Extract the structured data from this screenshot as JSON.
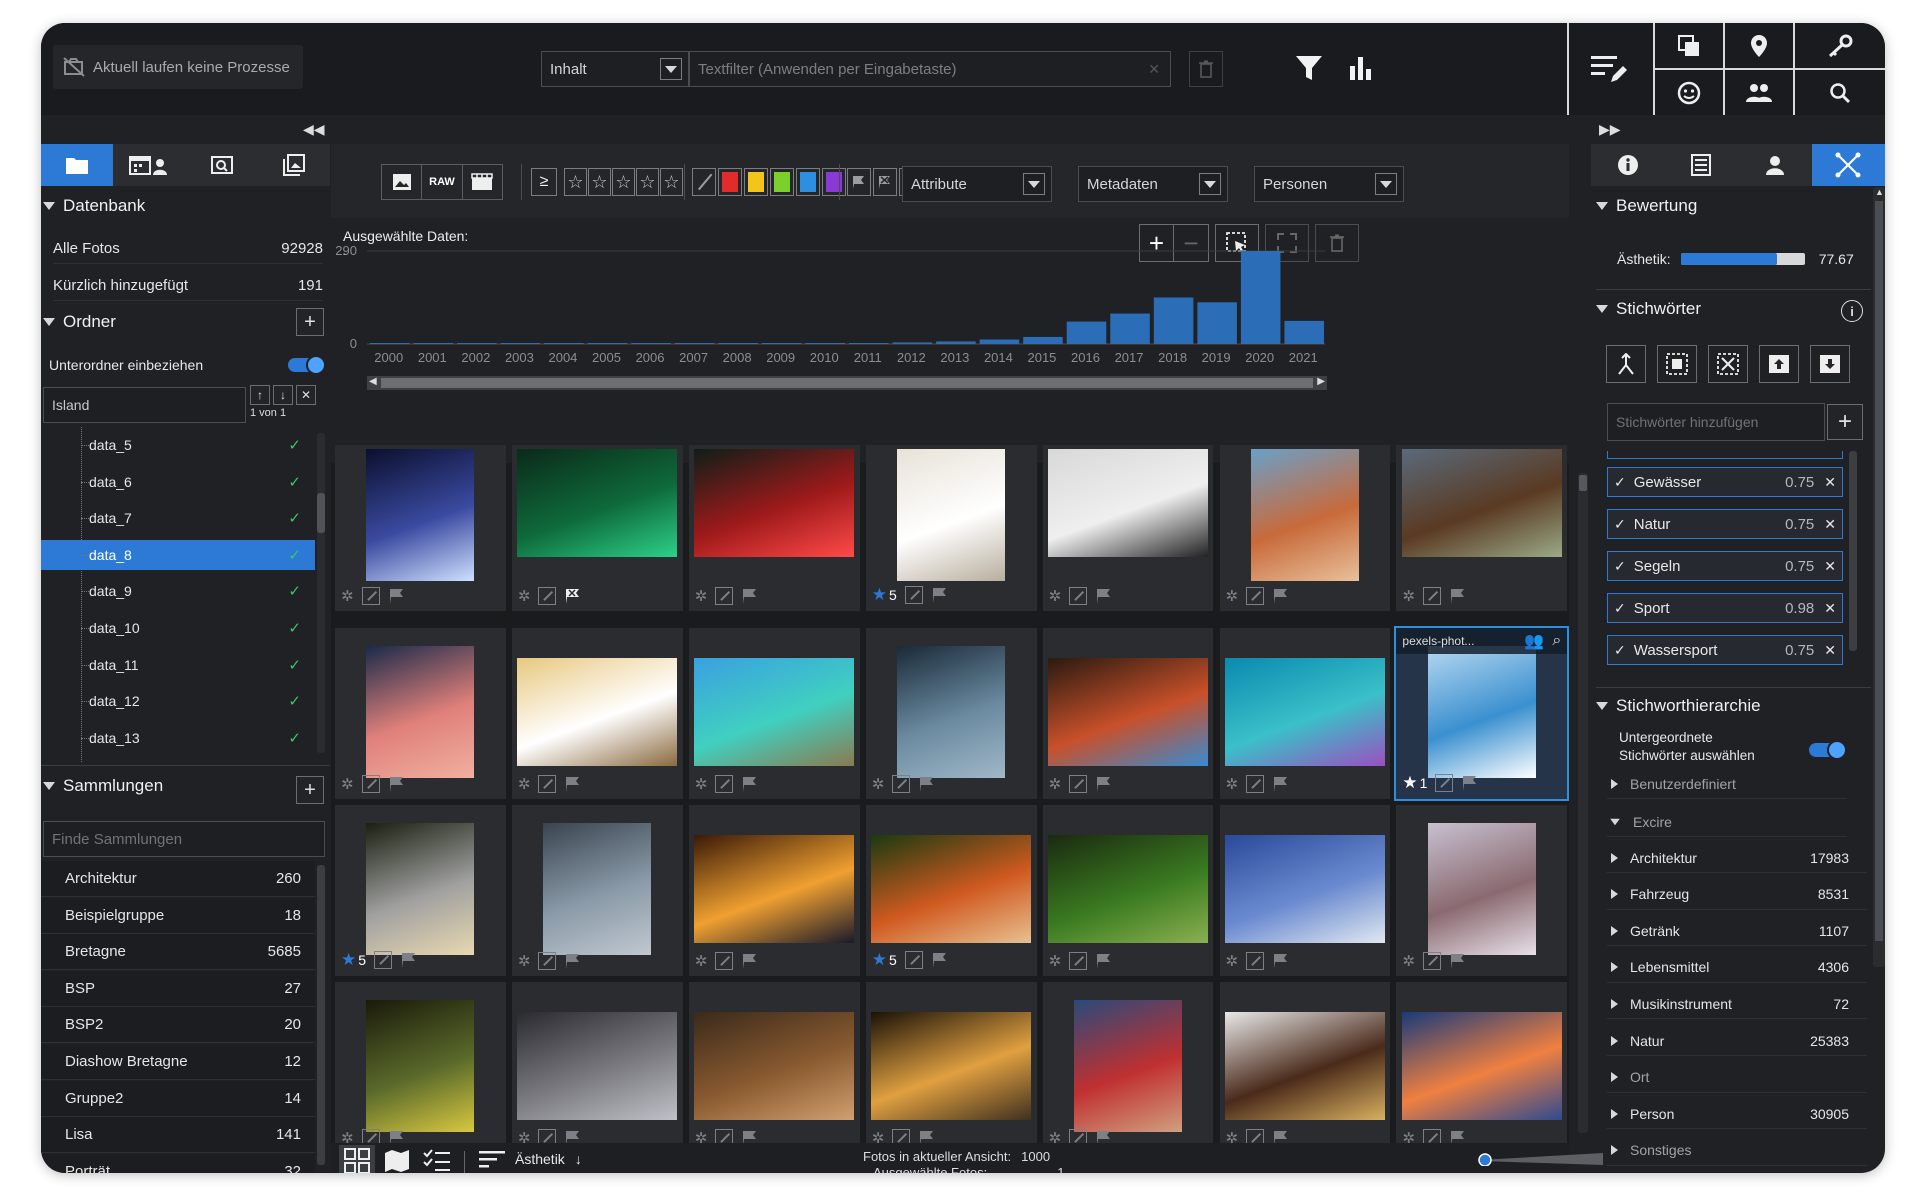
{
  "topbar": {
    "process_status": "Aktuell laufen keine Prozesse",
    "filter_type": "Inhalt",
    "textfilter_placeholder": "Textfilter (Anwenden per Eingabetaste)"
  },
  "left": {
    "db_title": "Datenbank",
    "db_items": [
      {
        "label": "Alle Fotos",
        "count": "92928"
      },
      {
        "label": "Kürzlich hinzugefügt",
        "count": "191"
      }
    ],
    "folders_title": "Ordner",
    "subfolders_label": "Unterordner einbeziehen",
    "folder_search_value": "Island",
    "folder_pager": "1 von 1",
    "folders": [
      "data_5",
      "data_6",
      "data_7",
      "data_8",
      "data_9",
      "data_10",
      "data_11",
      "data_12",
      "data_13"
    ],
    "selected_folder": "data_8",
    "collections_title": "Sammlungen",
    "collections_placeholder": "Finde Sammlungen",
    "collections": [
      {
        "label": "Architektur",
        "count": "260"
      },
      {
        "label": "Beispielgruppe",
        "count": "18"
      },
      {
        "label": "Bretagne",
        "count": "5685"
      },
      {
        "label": "BSP",
        "count": "27"
      },
      {
        "label": "BSP2",
        "count": "20"
      },
      {
        "label": "Diashow Bretagne",
        "count": "12"
      },
      {
        "label": "Gruppe2",
        "count": "14"
      },
      {
        "label": "Lisa",
        "count": "141"
      },
      {
        "label": "Porträt",
        "count": "32"
      }
    ]
  },
  "filterbar": {
    "raw_label": "RAW",
    "attribute": "Attribute",
    "metadata": "Metadaten",
    "persons": "Personen",
    "color_labels": [
      "#e32b2b",
      "#f2c518",
      "#7bd12a",
      "#2d8fe0",
      "#8a38d8"
    ]
  },
  "chart": {
    "title": "Ausgewählte Daten:",
    "subtitle": "-"
  },
  "chart_data": {
    "type": "bar",
    "categories": [
      "2000",
      "2001",
      "2002",
      "2003",
      "2004",
      "2005",
      "2006",
      "2007",
      "2008",
      "2009",
      "2010",
      "2011",
      "2012",
      "2013",
      "2014",
      "2015",
      "2016",
      "2017",
      "2018",
      "2019",
      "2020",
      "2021"
    ],
    "values": [
      1,
      1,
      1,
      1,
      1,
      1,
      1,
      1,
      1,
      1,
      2,
      3,
      5,
      8,
      14,
      22,
      70,
      95,
      145,
      130,
      290,
      72
    ],
    "ylim": [
      0,
      290
    ],
    "yticks": [
      "0",
      "290"
    ]
  },
  "grid": {
    "hover_filename": "pexels-phot...",
    "ratings": [
      {
        "cell": 3,
        "value": "5"
      },
      {
        "cell": 13,
        "value": "1"
      },
      {
        "cell": 14,
        "value": "5"
      },
      {
        "cell": 17,
        "value": "5"
      }
    ]
  },
  "bottom": {
    "sort_label": "Ästhetik",
    "photos_in_view_label": "Fotos in aktueller Ansicht:",
    "photos_in_view_value": "1000",
    "selected_photos_label": "Ausgewählte Fotos:",
    "selected_photos_value": "1"
  },
  "right": {
    "rating_title": "Bewertung",
    "aesthetic_label": "Ästhetik:",
    "aesthetic_value": "77.67",
    "aesthetic_fraction": 0.7767,
    "keywords_title": "Stichwörter",
    "keyword_placeholder": "Stichwörter hinzufügen",
    "keywords": [
      {
        "label": "Gewässer",
        "score": "0.75"
      },
      {
        "label": "Natur",
        "score": "0.75"
      },
      {
        "label": "Segeln",
        "score": "0.75"
      },
      {
        "label": "Sport",
        "score": "0.98"
      },
      {
        "label": "Wassersport",
        "score": "0.75"
      }
    ],
    "hierarchy_title": "Stichworthierarchie",
    "sub_keywords_line1": "Untergeordnete",
    "sub_keywords_line2": "Stichwörter auswählen",
    "hier_user": "Benutzerdefiniert",
    "hier_excire": "Excire",
    "hierarchy": [
      {
        "label": "Architektur",
        "count": "17983"
      },
      {
        "label": "Fahrzeug",
        "count": "8531"
      },
      {
        "label": "Getränk",
        "count": "1107"
      },
      {
        "label": "Lebensmittel",
        "count": "4306"
      },
      {
        "label": "Musikinstrument",
        "count": "72"
      },
      {
        "label": "Natur",
        "count": "25383"
      },
      {
        "label": "Ort",
        "count": ""
      },
      {
        "label": "Person",
        "count": "30905"
      },
      {
        "label": "Sonstiges",
        "count": ""
      }
    ]
  }
}
